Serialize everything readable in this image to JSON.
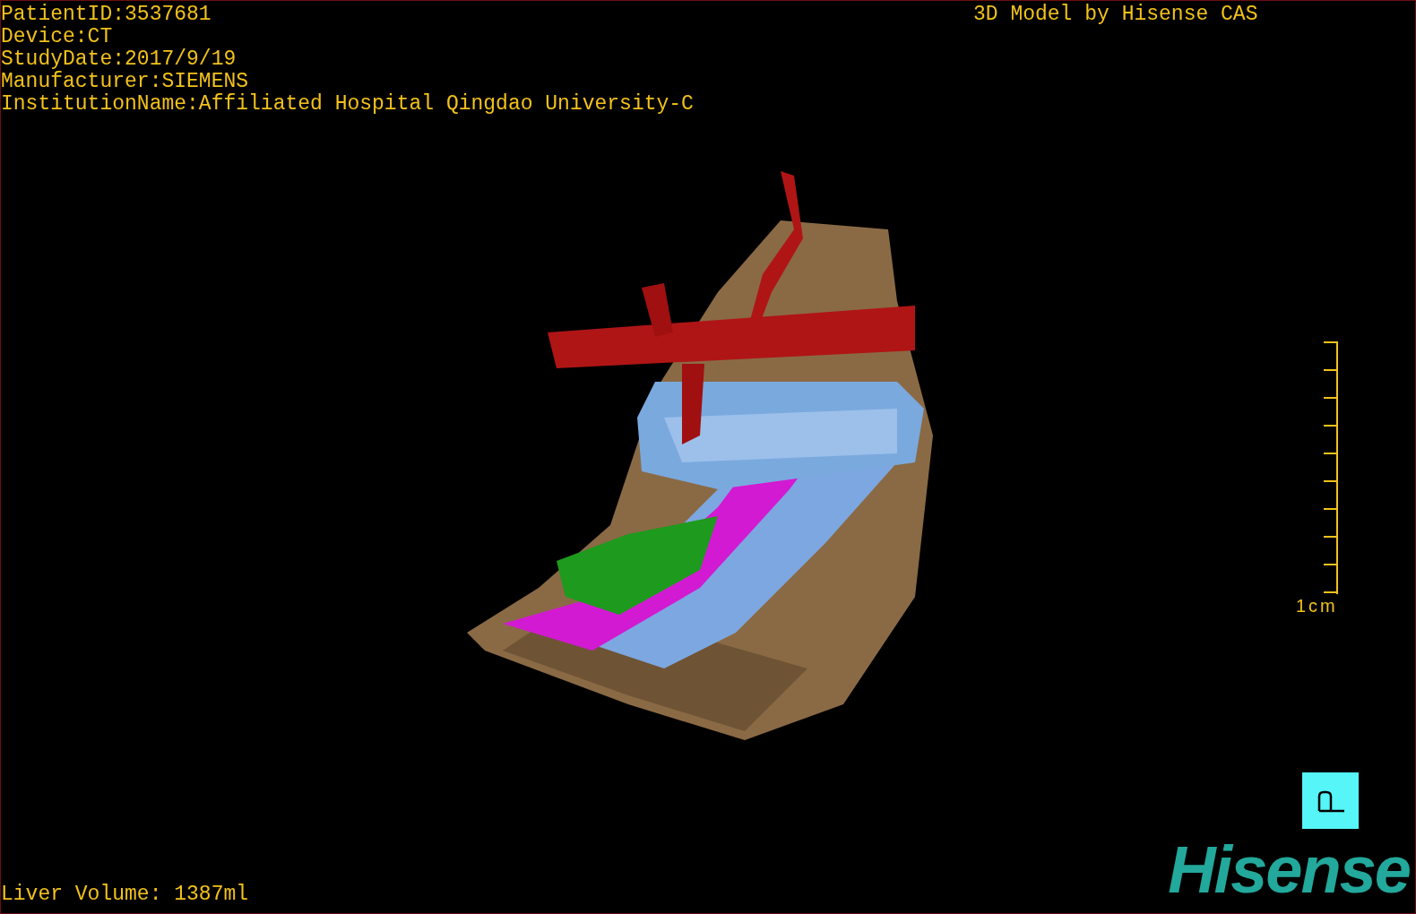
{
  "viewer": {
    "info_lines": [
      "PatientID:3537681",
      "Device:CT",
      "StudyDate:2017/9/19",
      "Manufacturer:SIEMENS",
      "InstitutionName:Affiliated Hospital Qingdao University-C"
    ],
    "model_caption": "3D Model by Hisense CAS",
    "scale_label": "1cm",
    "liver_volume": "Liver Volume: 1387ml",
    "logo": "Hisense"
  }
}
